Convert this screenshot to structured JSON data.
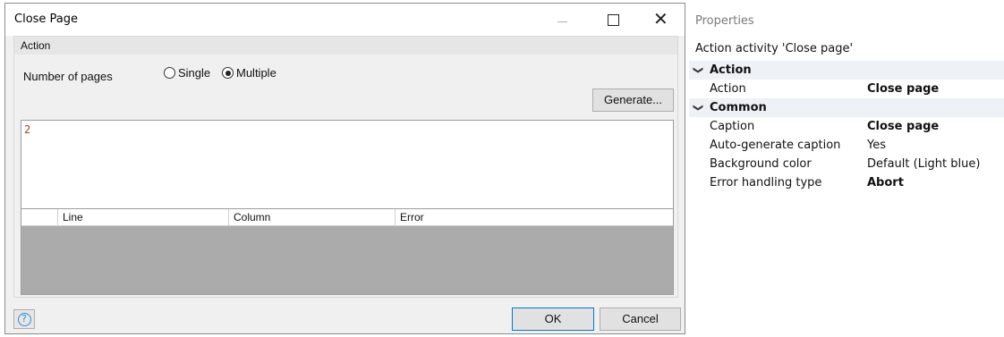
{
  "dialog": {
    "title": "Close Page",
    "group_title": "Action",
    "pages_label": "Number of pages",
    "radio_single": "Single",
    "radio_multiple": "Multiple",
    "selected": "Multiple",
    "generate_label": "Generate...",
    "editor_value": "2",
    "table_columns": [
      "",
      "Line",
      "Column",
      "Error"
    ],
    "ok_label": "OK",
    "cancel_label": "Cancel",
    "help_glyph": "?"
  },
  "properties": {
    "title": "Properties",
    "subtitle": "Action activity 'Close page'",
    "categories": [
      {
        "label": "Action",
        "rows": [
          {
            "name": "Action",
            "value": "Close page",
            "bold": true
          }
        ]
      },
      {
        "label": "Common",
        "rows": [
          {
            "name": "Caption",
            "value": "Close page",
            "bold": true
          },
          {
            "name": "Auto-generate caption",
            "value": "Yes",
            "bold": false
          },
          {
            "name": "Background color",
            "value": "Default (Light blue)",
            "bold": false
          },
          {
            "name": "Error handling type",
            "value": "Abort",
            "bold": true
          }
        ]
      }
    ]
  },
  "colors": {
    "accent": "#0078d7",
    "editor_text": "#b23a1e",
    "help_icon": "#2b8fd6"
  }
}
